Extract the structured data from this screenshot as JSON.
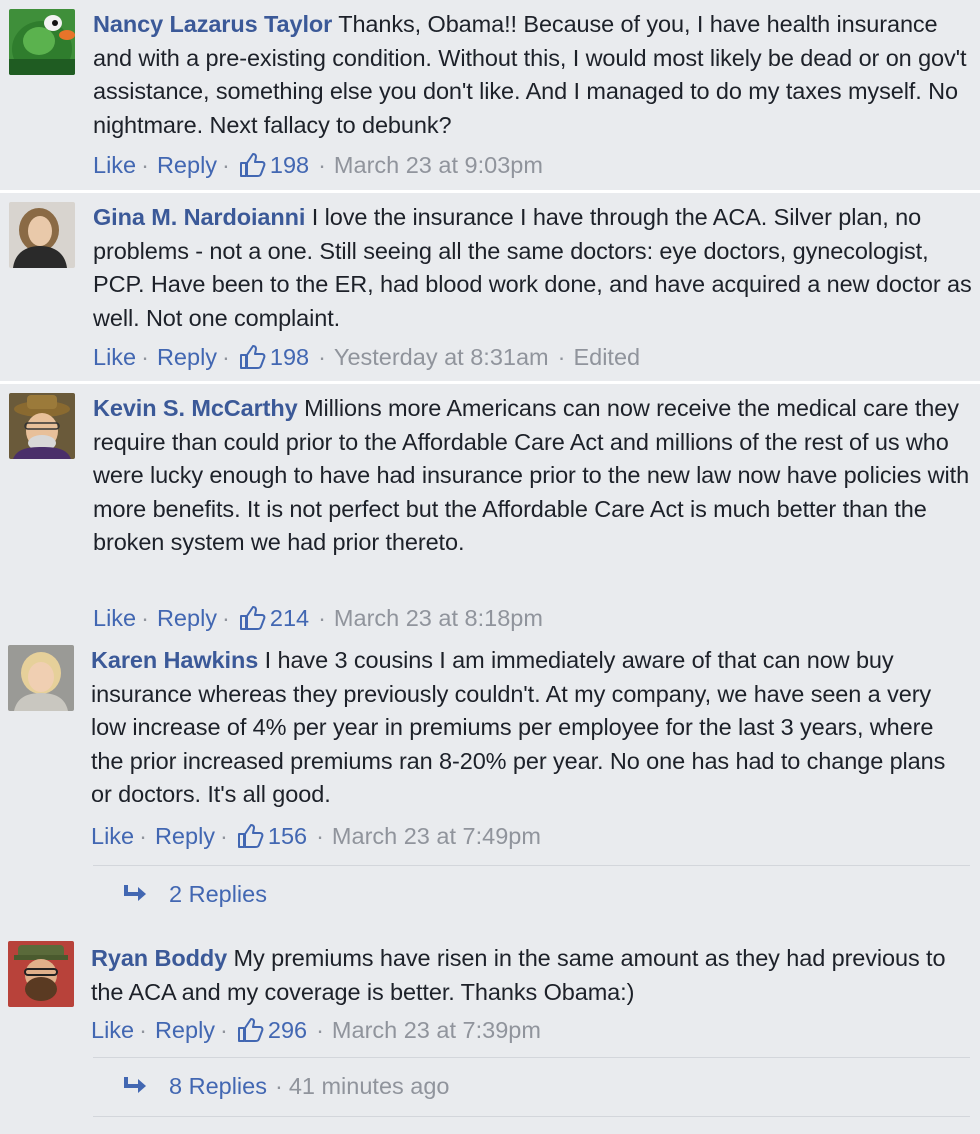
{
  "actions": {
    "like": "Like",
    "reply": "Reply",
    "sep": "·"
  },
  "colors": {
    "link": "#4267b2",
    "author": "#3b5998",
    "meta": "#90949c",
    "background": "#e9ebee"
  },
  "comments": [
    {
      "author": "Nancy Lazarus Taylor",
      "text": "Thanks, Obama!! Because of you, I have health insurance and with a pre-existing condition. Without this, I would most likely be dead or on gov't assistance, something else you don't like. And I managed to do my taxes myself. No nightmare. Next fallacy to debunk?",
      "likes": "198",
      "time": "March 23 at 9:03pm",
      "edited": "",
      "avatar": "green-mascot-avatar"
    },
    {
      "author": "Gina M. Nardoianni",
      "text": "I love the insurance I have through the ACA. Silver plan, no problems - not a one. Still seeing all the same doctors: eye doctors, gynecologist, PCP. Have been to the ER, had blood work done, and have acquired a new doctor as well. Not one complaint.",
      "likes": "198",
      "time": "Yesterday at 8:31am",
      "edited": "Edited",
      "avatar": "woman-photo-avatar"
    },
    {
      "author": "Kevin S. McCarthy",
      "text": "Millions more Americans can now receive the medical care they require than could prior to the Affordable Care Act and millions of the rest of us who were lucky enough to have had insurance prior to the new law now have policies with more benefits. It is not perfect but the Affordable Care Act is much better than the broken system we had prior thereto.",
      "likes": "214",
      "time": "March 23 at 8:18pm",
      "edited": "",
      "avatar": "hat-man-avatar"
    },
    {
      "author": "Karen Hawkins",
      "text": "I have 3 cousins I am immediately aware of that can now buy insurance whereas they previously couldn't. At my company, we have seen a very low increase of 4% per year in premiums per employee for the last 3 years, where the prior increased premiums ran 8-20% per year. No one has had to change plans or doctors. It's all good.",
      "likes": "156",
      "time": "March 23 at 7:49pm",
      "edited": "",
      "avatar": "blonde-woman-avatar",
      "replies": {
        "label": "2 Replies",
        "time": ""
      }
    },
    {
      "author": "Ryan Boddy",
      "text": "My premiums have risen in the same amount as they had previous to the ACA and my coverage is better. Thanks Obama:)",
      "likes": "296",
      "time": "March 23 at 7:39pm",
      "edited": "",
      "avatar": "bearded-man-avatar",
      "replies": {
        "label": "8 Replies",
        "time": "41 minutes ago"
      }
    }
  ]
}
